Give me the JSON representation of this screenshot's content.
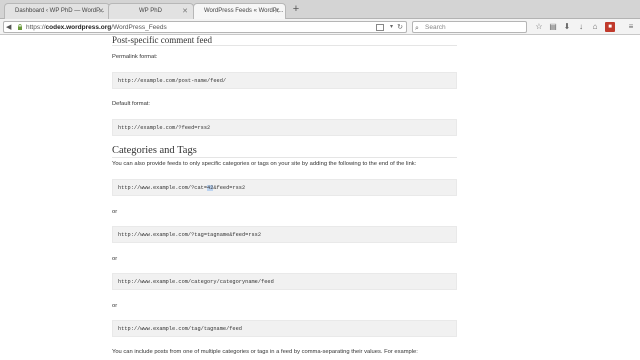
{
  "tabs": [
    {
      "label": "Dashboard ‹ WP PhD — WordP...",
      "active": false
    },
    {
      "label": "WP PhD",
      "active": false
    },
    {
      "label": "WordPress Feeds « WordPr...",
      "active": true
    }
  ],
  "new_tab": "+",
  "toolbar": {
    "url_prefix": "https://",
    "url_host": "codex.wordpress.org",
    "url_path": "/WordPress_Feeds",
    "search_placeholder": "Search"
  },
  "sections": {
    "post_comment_heading": "Post-specific comment feed",
    "permalink_label": "Permalink format:",
    "permalink_code": "http://example.com/post-name/feed/",
    "default_label": "Default format:",
    "default_code": "http://example.com/?feed=rss2",
    "cat_heading": "Categories and Tags",
    "cat_intro": "You can also provide feeds to only specific categories or tags on your site by adding the following to the end of the link:",
    "code1_pre": "http://www.example.com/?cat=",
    "code1_sel": "42",
    "code1_post": "&feed=rss2",
    "or1": "or",
    "code2": "http://www.example.com/?tag=tagname&feed=rss2",
    "or2": "or",
    "code3": "http://www.example.com/category/categoryname/feed",
    "or3": "or",
    "code4": "http://www.example.com/tag/tagname/feed",
    "multi_intro": "You can include posts from one of multiple categories or tags in a feed by comma-separating their values. For example:"
  },
  "icons": [
    "back-icon",
    "lock-icon",
    "reader-icon",
    "reload-icon",
    "search-icon",
    "star-icon",
    "clipboard-icon",
    "download-icon",
    "home-icon",
    "extension-icon",
    "menu-icon"
  ]
}
